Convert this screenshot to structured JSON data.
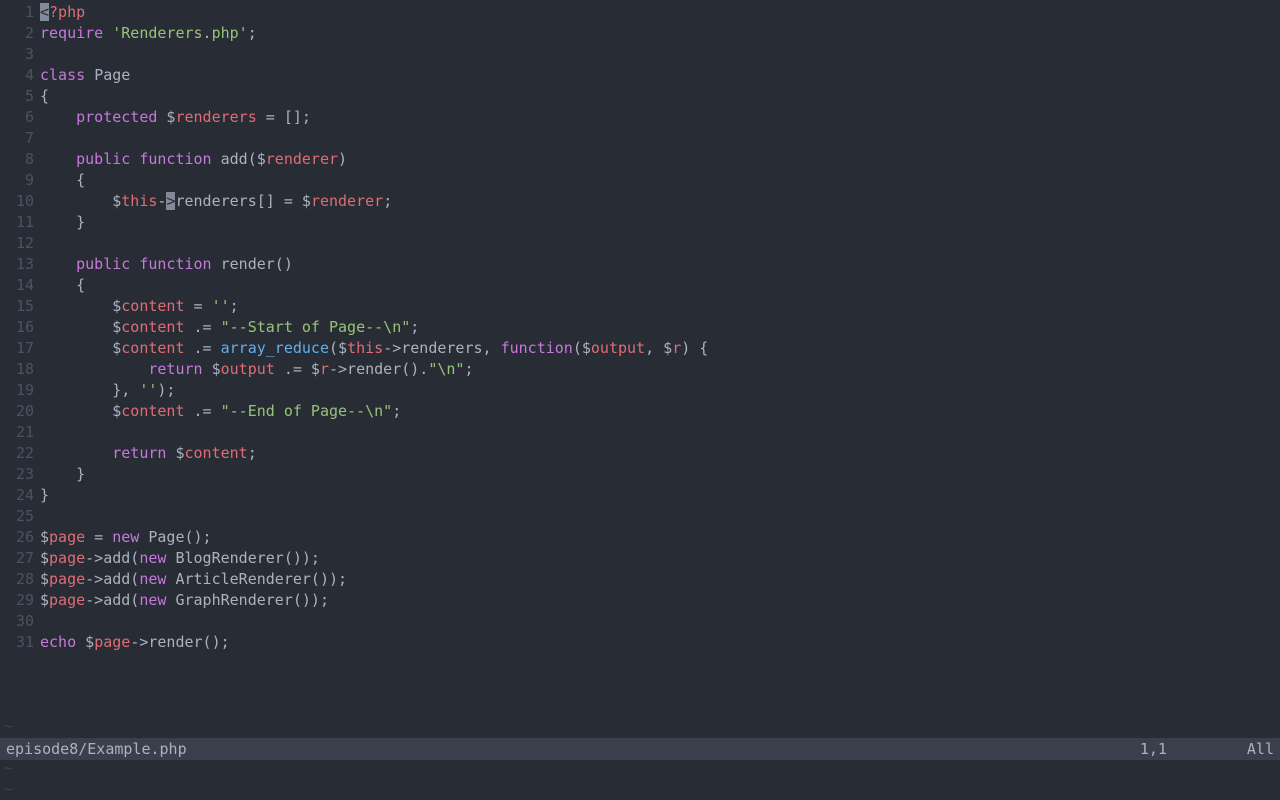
{
  "status": {
    "file": "episode8/Example.php",
    "pos": "1,1",
    "scroll": "All"
  },
  "tilde": "~",
  "lines": [
    {
      "n": 1,
      "t": [
        [
          "cursor",
          "<"
        ],
        [
          "var",
          "?php"
        ]
      ]
    },
    {
      "n": 2,
      "t": [
        [
          "kw",
          "require"
        ],
        [
          "plain",
          " "
        ],
        [
          "str",
          "'Renderers.php'"
        ],
        [
          "plain",
          ";"
        ]
      ]
    },
    {
      "n": 3,
      "t": [
        [
          "plain",
          ""
        ]
      ]
    },
    {
      "n": 4,
      "t": [
        [
          "kw",
          "class"
        ],
        [
          "plain",
          " "
        ],
        [
          "plain",
          "Page"
        ]
      ]
    },
    {
      "n": 5,
      "t": [
        [
          "plain",
          "{"
        ]
      ]
    },
    {
      "n": 6,
      "t": [
        [
          "plain",
          "    "
        ],
        [
          "kw",
          "protected"
        ],
        [
          "plain",
          " $"
        ],
        [
          "var",
          "renderers"
        ],
        [
          "plain",
          " = [];"
        ]
      ]
    },
    {
      "n": 7,
      "t": [
        [
          "plain",
          ""
        ]
      ]
    },
    {
      "n": 8,
      "t": [
        [
          "plain",
          "    "
        ],
        [
          "kw",
          "public"
        ],
        [
          "plain",
          " "
        ],
        [
          "kw",
          "function"
        ],
        [
          "plain",
          " "
        ],
        [
          "plain",
          "add($"
        ],
        [
          "var",
          "renderer"
        ],
        [
          "plain",
          ")"
        ]
      ]
    },
    {
      "n": 9,
      "t": [
        [
          "plain",
          "    {"
        ]
      ]
    },
    {
      "n": 10,
      "t": [
        [
          "plain",
          "        $"
        ],
        [
          "var",
          "this"
        ],
        [
          "plain",
          "-"
        ],
        [
          "cursor",
          ">"
        ],
        [
          "plain",
          "renderers[] = $"
        ],
        [
          "var",
          "renderer"
        ],
        [
          "plain",
          ";"
        ]
      ]
    },
    {
      "n": 11,
      "t": [
        [
          "plain",
          "    }"
        ]
      ]
    },
    {
      "n": 12,
      "t": [
        [
          "plain",
          ""
        ]
      ]
    },
    {
      "n": 13,
      "t": [
        [
          "plain",
          "    "
        ],
        [
          "kw",
          "public"
        ],
        [
          "plain",
          " "
        ],
        [
          "kw",
          "function"
        ],
        [
          "plain",
          " "
        ],
        [
          "plain",
          "render()"
        ]
      ]
    },
    {
      "n": 14,
      "t": [
        [
          "plain",
          "    {"
        ]
      ]
    },
    {
      "n": 15,
      "t": [
        [
          "plain",
          "        $"
        ],
        [
          "var",
          "content"
        ],
        [
          "plain",
          " = "
        ],
        [
          "str",
          "''"
        ],
        [
          "plain",
          ";"
        ]
      ]
    },
    {
      "n": 16,
      "t": [
        [
          "plain",
          "        $"
        ],
        [
          "var",
          "content"
        ],
        [
          "plain",
          " .= "
        ],
        [
          "str",
          "\"--Start of Page--\\n\""
        ],
        [
          "plain",
          ";"
        ]
      ]
    },
    {
      "n": 17,
      "t": [
        [
          "plain",
          "        $"
        ],
        [
          "var",
          "content"
        ],
        [
          "plain",
          " .= "
        ],
        [
          "fn",
          "array_reduce"
        ],
        [
          "plain",
          "($"
        ],
        [
          "var",
          "this"
        ],
        [
          "plain",
          "->renderers, "
        ],
        [
          "kw",
          "function"
        ],
        [
          "plain",
          "($"
        ],
        [
          "var",
          "output"
        ],
        [
          "plain",
          ", $"
        ],
        [
          "var",
          "r"
        ],
        [
          "plain",
          ") {"
        ]
      ]
    },
    {
      "n": 18,
      "t": [
        [
          "plain",
          "            "
        ],
        [
          "kw",
          "return"
        ],
        [
          "plain",
          " $"
        ],
        [
          "var",
          "output"
        ],
        [
          "plain",
          " .= $"
        ],
        [
          "var",
          "r"
        ],
        [
          "plain",
          "->render()."
        ],
        [
          "str",
          "\"\\n\""
        ],
        [
          "plain",
          ";"
        ]
      ]
    },
    {
      "n": 19,
      "t": [
        [
          "plain",
          "        }, "
        ],
        [
          "str",
          "''"
        ],
        [
          "plain",
          ");"
        ]
      ]
    },
    {
      "n": 20,
      "t": [
        [
          "plain",
          "        $"
        ],
        [
          "var",
          "content"
        ],
        [
          "plain",
          " .= "
        ],
        [
          "str",
          "\"--End of Page--\\n\""
        ],
        [
          "plain",
          ";"
        ]
      ]
    },
    {
      "n": 21,
      "t": [
        [
          "plain",
          ""
        ]
      ]
    },
    {
      "n": 22,
      "t": [
        [
          "plain",
          "        "
        ],
        [
          "kw",
          "return"
        ],
        [
          "plain",
          " $"
        ],
        [
          "var",
          "content"
        ],
        [
          "plain",
          ";"
        ]
      ]
    },
    {
      "n": 23,
      "t": [
        [
          "plain",
          "    }"
        ]
      ]
    },
    {
      "n": 24,
      "t": [
        [
          "plain",
          "}"
        ]
      ]
    },
    {
      "n": 25,
      "t": [
        [
          "plain",
          ""
        ]
      ]
    },
    {
      "n": 26,
      "t": [
        [
          "plain",
          "$"
        ],
        [
          "var",
          "page"
        ],
        [
          "plain",
          " = "
        ],
        [
          "kw",
          "new"
        ],
        [
          "plain",
          " Page();"
        ]
      ]
    },
    {
      "n": 27,
      "t": [
        [
          "plain",
          "$"
        ],
        [
          "var",
          "page"
        ],
        [
          "plain",
          "->add("
        ],
        [
          "kw",
          "new"
        ],
        [
          "plain",
          " BlogRenderer());"
        ]
      ]
    },
    {
      "n": 28,
      "t": [
        [
          "plain",
          "$"
        ],
        [
          "var",
          "page"
        ],
        [
          "plain",
          "->add("
        ],
        [
          "kw",
          "new"
        ],
        [
          "plain",
          " ArticleRenderer());"
        ]
      ]
    },
    {
      "n": 29,
      "t": [
        [
          "plain",
          "$"
        ],
        [
          "var",
          "page"
        ],
        [
          "plain",
          "->add("
        ],
        [
          "kw",
          "new"
        ],
        [
          "plain",
          " GraphRenderer());"
        ]
      ]
    },
    {
      "n": 30,
      "t": [
        [
          "plain",
          ""
        ]
      ]
    },
    {
      "n": 31,
      "t": [
        [
          "kw",
          "echo"
        ],
        [
          "plain",
          " $"
        ],
        [
          "var",
          "page"
        ],
        [
          "plain",
          "->render();"
        ]
      ]
    }
  ]
}
